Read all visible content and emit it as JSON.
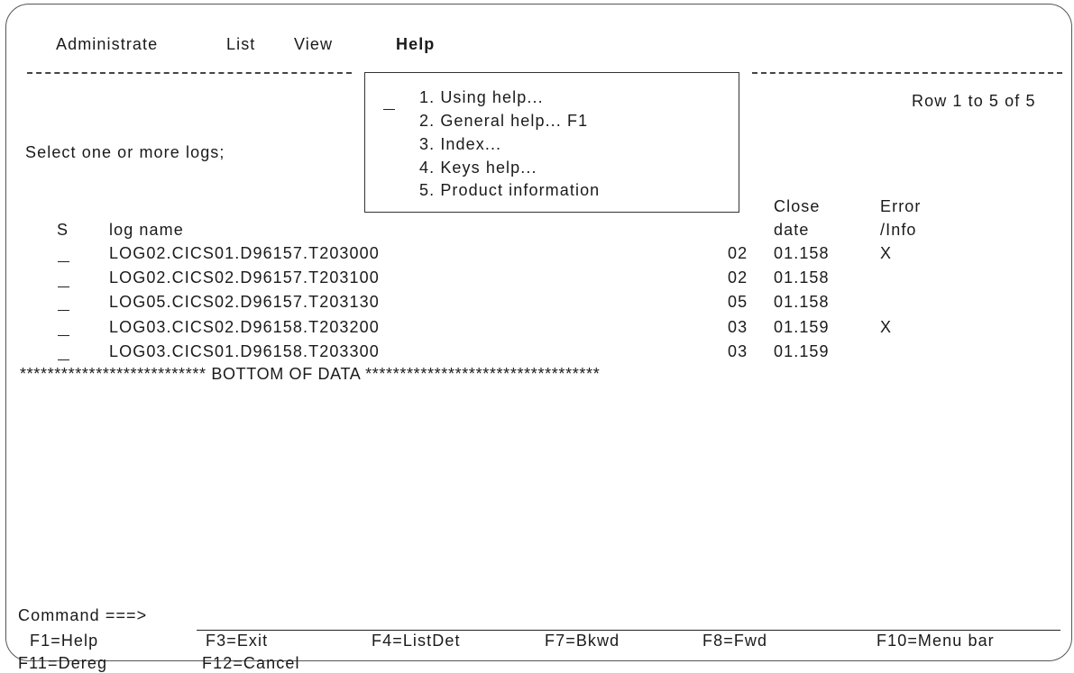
{
  "menu_bar": {
    "items": [
      "Administrate",
      "List",
      "View",
      "Help"
    ],
    "active": "Help"
  },
  "header": {
    "row_info": "Row 1 to 5 of 5",
    "instruction": "Select one or more logs;"
  },
  "help_menu": {
    "items": [
      "1. Using help...",
      "2. General help... F1",
      "3. Index...",
      "4. Keys help...",
      "5. Product information"
    ]
  },
  "table": {
    "col_select": "S",
    "col_log_name": "log name",
    "col_close_line1": "Close",
    "col_close_line2": "date",
    "col_error_line1": "Error",
    "col_error_line2": "/Info",
    "rows": [
      {
        "name": "LOG02.CICS01.D96157.T203000",
        "num": "02",
        "date": "01.158",
        "flag": "X"
      },
      {
        "name": "LOG02.CICS02.D96157.T203100",
        "num": "02",
        "date": "01.158",
        "flag": ""
      },
      {
        "name": "LOG05.CICS02.D96157.T203130",
        "num": "05",
        "date": "01.158",
        "flag": ""
      },
      {
        "name": "LOG03.CICS02.D96158.T203200",
        "num": "03",
        "date": "01.159",
        "flag": "X"
      },
      {
        "name": "LOG03.CICS01.D96158.T203300",
        "num": "03",
        "date": "01.159",
        "flag": ""
      }
    ]
  },
  "bottom_banner": "*************************** BOTTOM OF DATA **********************************",
  "command": {
    "label": "Command ===>",
    "value": ""
  },
  "function_keys": {
    "f1": "F1=Help",
    "f3": "F3=Exit",
    "f4": "F4=ListDet",
    "f7": "F7=Bkwd",
    "f8": "F8=Fwd",
    "f10": "F10=Menu bar",
    "f11": "F11=Dereg",
    "f12": "F12=Cancel"
  }
}
